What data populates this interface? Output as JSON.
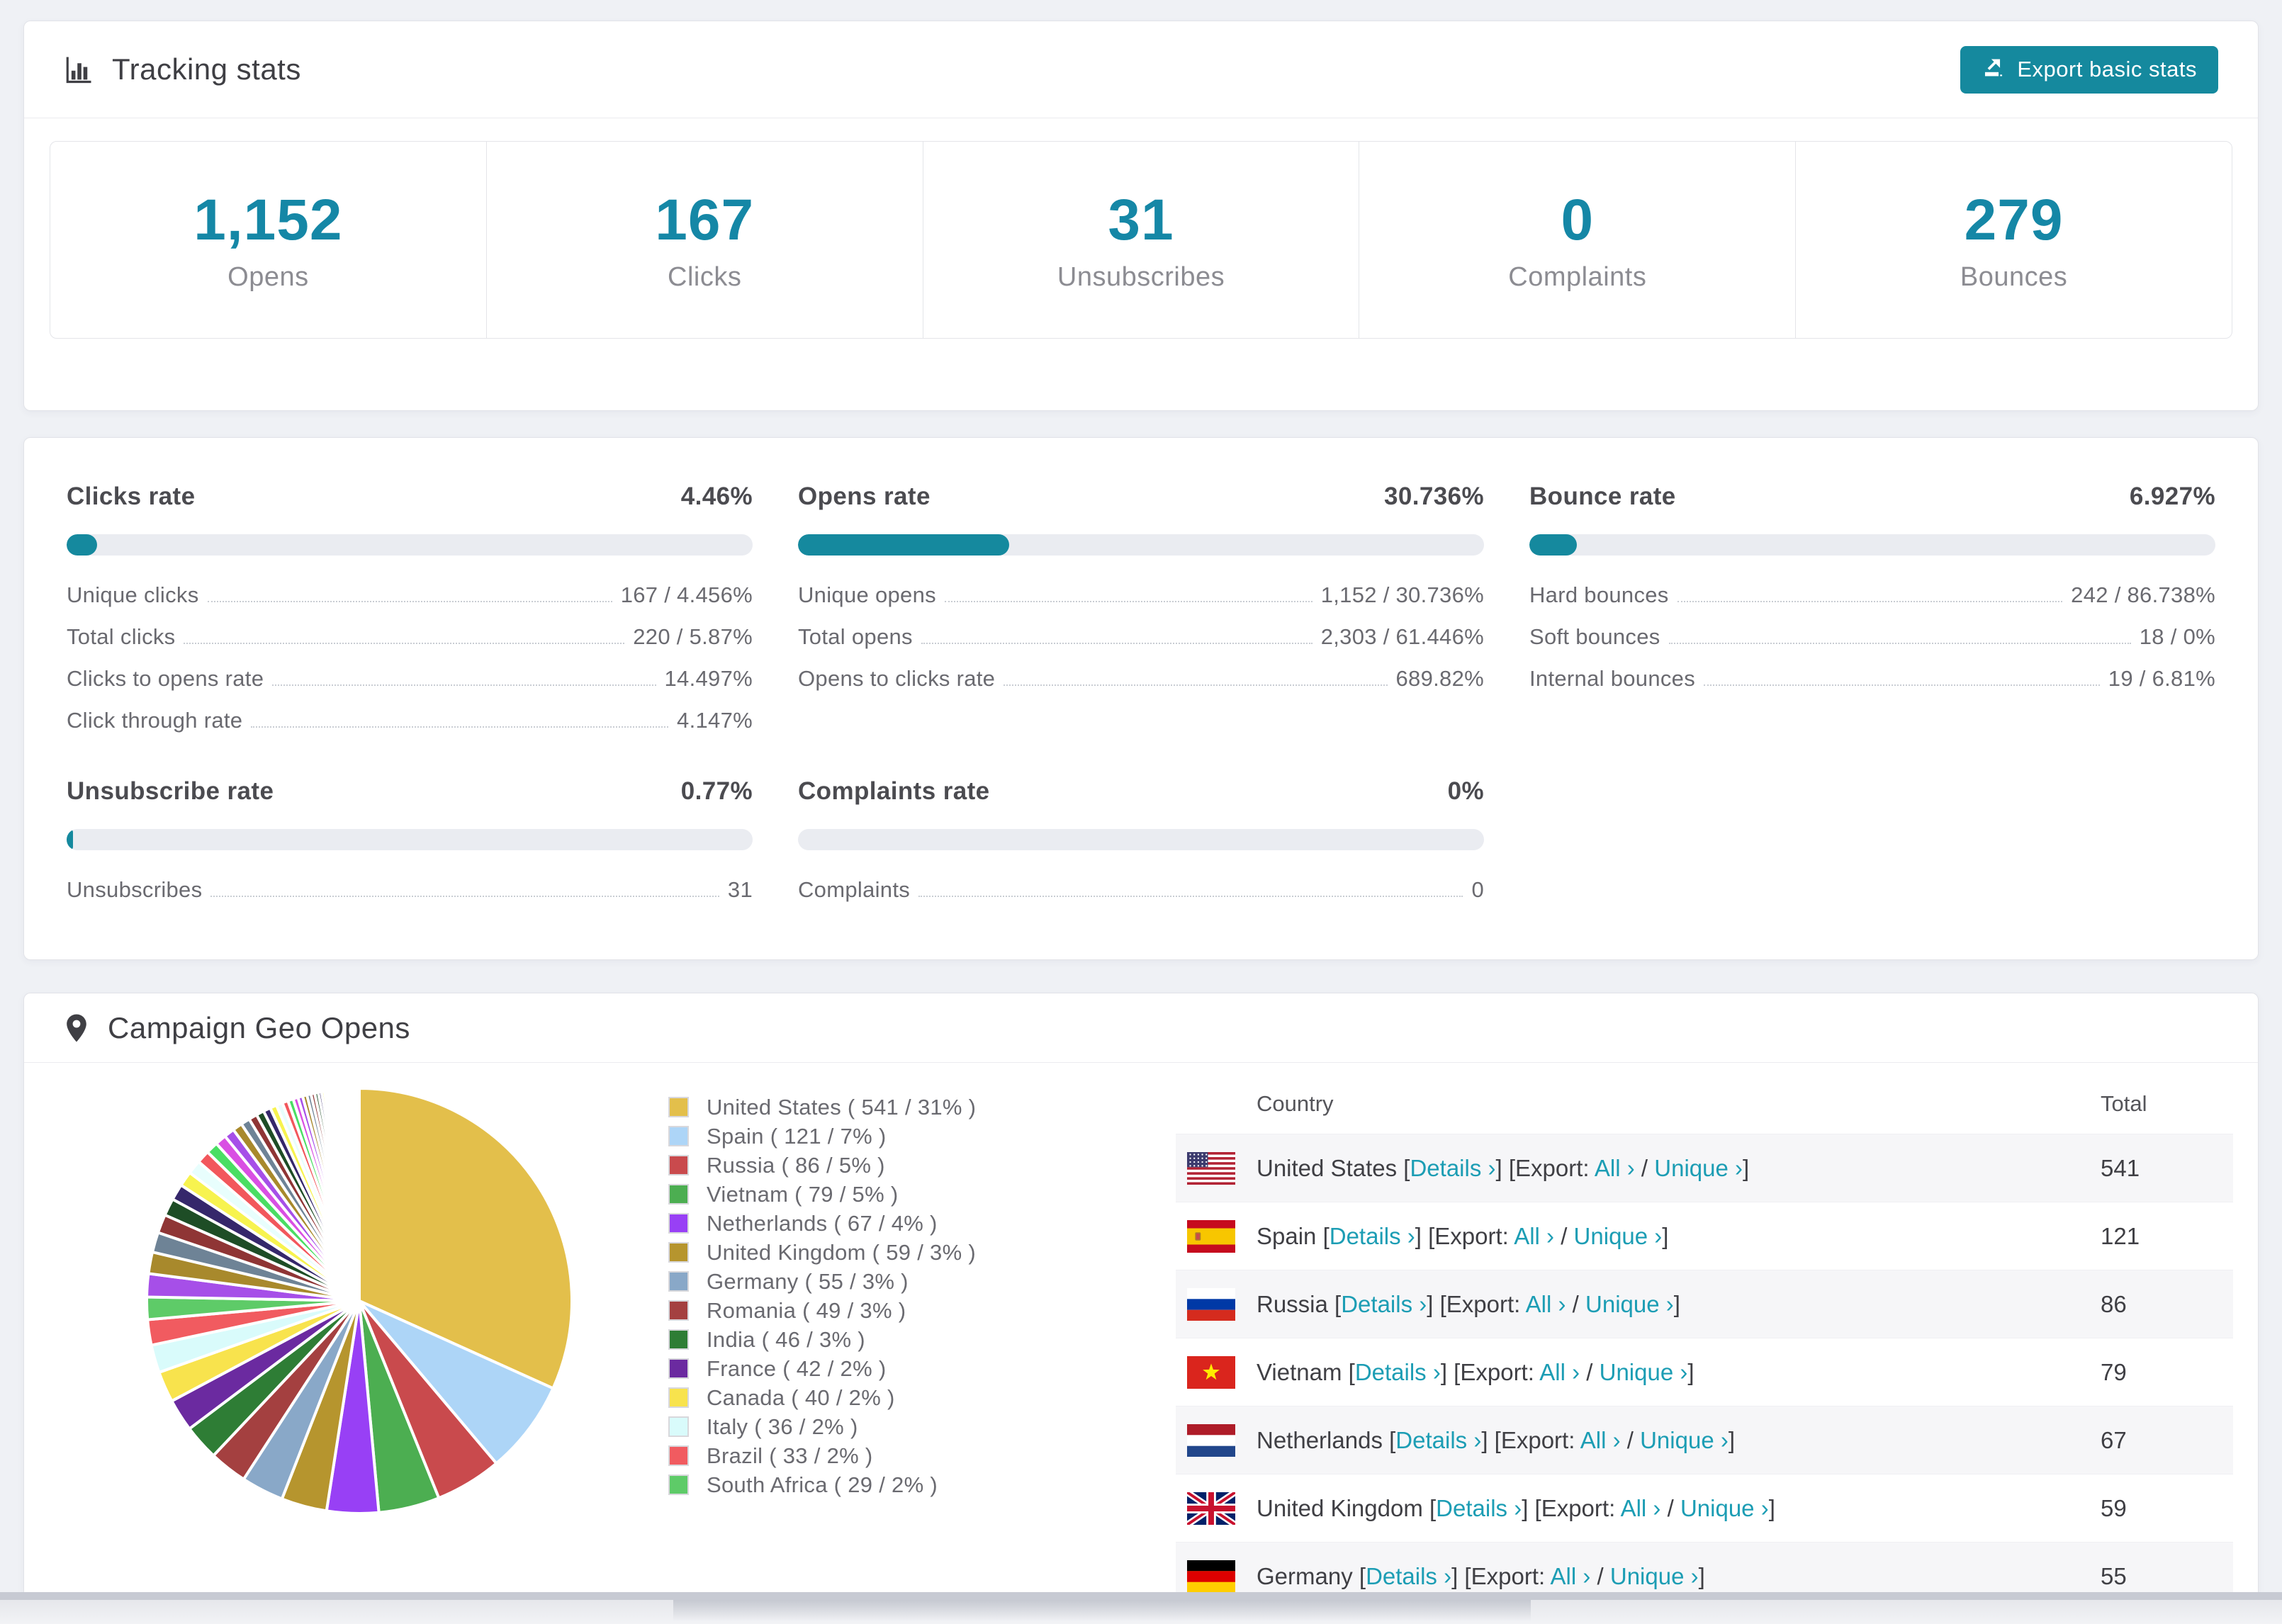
{
  "colors": {
    "accent": "#15899E",
    "link": "#1C9DB4",
    "stat_number": "#1587A6",
    "bar_track": "#EAECF1",
    "row_stripe": "#F6F6F8",
    "page_bg": "#EFF1F5"
  },
  "tracking": {
    "title": "Tracking stats",
    "export_label": "Export basic stats",
    "summary": [
      {
        "value": "1,152",
        "label": "Opens"
      },
      {
        "value": "167",
        "label": "Clicks"
      },
      {
        "value": "31",
        "label": "Unsubscribes"
      },
      {
        "value": "0",
        "label": "Complaints"
      },
      {
        "value": "279",
        "label": "Bounces"
      }
    ]
  },
  "rates": [
    {
      "title": "Clicks rate",
      "value": "4.46%",
      "percent": 4.46,
      "rows": [
        {
          "label": "Unique clicks",
          "value": "167 / 4.456%"
        },
        {
          "label": "Total clicks",
          "value": "220 / 5.87%"
        },
        {
          "label": "Clicks to opens rate",
          "value": "14.497%"
        },
        {
          "label": "Click through rate",
          "value": "4.147%"
        }
      ]
    },
    {
      "title": "Opens rate",
      "value": "30.736%",
      "percent": 30.736,
      "rows": [
        {
          "label": "Unique opens",
          "value": "1,152 / 30.736%"
        },
        {
          "label": "Total opens",
          "value": "2,303 / 61.446%"
        },
        {
          "label": "Opens to clicks rate",
          "value": "689.82%"
        }
      ]
    },
    {
      "title": "Bounce rate",
      "value": "6.927%",
      "percent": 6.927,
      "rows": [
        {
          "label": "Hard bounces",
          "value": "242 / 86.738%"
        },
        {
          "label": "Soft bounces",
          "value": "18 / 0%"
        },
        {
          "label": "Internal bounces",
          "value": "19 / 6.81%"
        }
      ]
    },
    {
      "title": "Unsubscribe rate",
      "value": "0.77%",
      "percent": 0.77,
      "rows": [
        {
          "label": "Unsubscribes",
          "value": "31"
        }
      ]
    },
    {
      "title": "Complaints rate",
      "value": "0%",
      "percent": 0,
      "rows": [
        {
          "label": "Complaints",
          "value": "0"
        }
      ]
    }
  ],
  "geo": {
    "title": "Campaign Geo Opens",
    "table": {
      "headers": [
        "Country",
        "Total"
      ],
      "labels": {
        "details": "Details ›",
        "export_prefix": "] [Export: ",
        "open_bracket": " [",
        "all": "All ›",
        "slash": " / ",
        "unique": "Unique ›",
        "close_bracket": "]"
      },
      "rows": [
        {
          "flag": "us",
          "country": "United States",
          "total": "541"
        },
        {
          "flag": "es",
          "country": "Spain",
          "total": "121"
        },
        {
          "flag": "ru",
          "country": "Russia",
          "total": "86"
        },
        {
          "flag": "vn",
          "country": "Vietnam",
          "total": "79"
        },
        {
          "flag": "nl",
          "country": "Netherlands",
          "total": "67"
        },
        {
          "flag": "gb",
          "country": "United Kingdom",
          "total": "59"
        },
        {
          "flag": "de",
          "country": "Germany",
          "total": "55",
          "partial": true
        }
      ]
    },
    "chart_data": {
      "type": "pie",
      "title": "Campaign Geo Opens",
      "legend_position": "right",
      "start_angle_deg": -90,
      "direction": "clockwise",
      "series": [
        {
          "name": "United States",
          "value": 541,
          "pct": 31,
          "color": "#E3BF4B"
        },
        {
          "name": "Spain",
          "value": 121,
          "pct": 7,
          "color": "#ADD5F7"
        },
        {
          "name": "Russia",
          "value": 86,
          "pct": 5,
          "color": "#C94A4D"
        },
        {
          "name": "Vietnam",
          "value": 79,
          "pct": 5,
          "color": "#4CAE51"
        },
        {
          "name": "Netherlands",
          "value": 67,
          "pct": 4,
          "color": "#9840F5"
        },
        {
          "name": "United Kingdom",
          "value": 59,
          "pct": 3,
          "color": "#B6952E"
        },
        {
          "name": "Germany",
          "value": 55,
          "pct": 3,
          "color": "#89A8C8"
        },
        {
          "name": "Romania",
          "value": 49,
          "pct": 3,
          "color": "#A44040"
        },
        {
          "name": "India",
          "value": 46,
          "pct": 3,
          "color": "#2E7D35"
        },
        {
          "name": "France",
          "value": 42,
          "pct": 2,
          "color": "#6B2AA0"
        },
        {
          "name": "Canada",
          "value": 40,
          "pct": 2,
          "color": "#F8E34D"
        },
        {
          "name": "Italy",
          "value": 36,
          "pct": 2,
          "color": "#D9FBFB"
        },
        {
          "name": "Brazil",
          "value": 33,
          "pct": 2,
          "color": "#F15B60"
        },
        {
          "name": "South Africa",
          "value": 29,
          "pct": 2,
          "color": "#5ECB68"
        }
      ],
      "others_unlabeled": {
        "note": "long tail of small unlabeled slices visible in the pie",
        "values": [
          30,
          27.9,
          25.9,
          24.1,
          22.4,
          20.9,
          19.4,
          18,
          16.8,
          15.6,
          14.5,
          13.5,
          12.6,
          11.7,
          10.9,
          10.1,
          9.4,
          8.7,
          8.1,
          7.6,
          7,
          6.5,
          6.1,
          5.7,
          5.3,
          4.9,
          4.6,
          4.2,
          3.9,
          3.7,
          3.4,
          3.2,
          3,
          2.8,
          2.6,
          2.4,
          2.2,
          2.1,
          1.9,
          1.8,
          1.7,
          1.5,
          1.4,
          1.3,
          1.2,
          1.2,
          1.1,
          1,
          0.9,
          0.9,
          0.8,
          0.7,
          0.7,
          0.6,
          0.6
        ],
        "palette": [
          "#A64FE8",
          "#A8892C",
          "#6E8396",
          "#8F3535",
          "#1E4D26",
          "#35276B",
          "#F7F34F",
          "#E8FEFD",
          "#F2575C",
          "#4ADE63",
          "#D94FE3"
        ]
      }
    }
  }
}
